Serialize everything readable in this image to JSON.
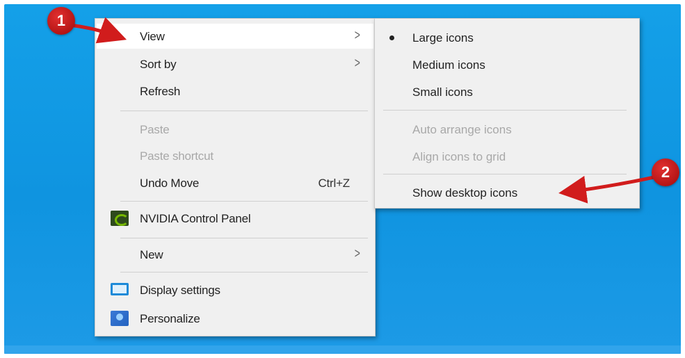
{
  "menu": {
    "items": [
      {
        "label": "View",
        "has_submenu": true,
        "highlighted": true
      },
      {
        "label": "Sort by",
        "has_submenu": true
      },
      {
        "label": "Refresh"
      },
      {
        "label": "Paste",
        "disabled": true
      },
      {
        "label": "Paste shortcut",
        "disabled": true
      },
      {
        "label": "Undo Move",
        "shortcut": "Ctrl+Z"
      },
      {
        "label": "NVIDIA Control Panel",
        "icon": "nvidia-icon"
      },
      {
        "label": "New",
        "has_submenu": true
      },
      {
        "label": "Display settings",
        "icon": "display-icon"
      },
      {
        "label": "Personalize",
        "icon": "personalize-icon"
      }
    ]
  },
  "submenu": {
    "items": [
      {
        "label": "Large icons",
        "selected": true
      },
      {
        "label": "Medium icons"
      },
      {
        "label": "Small icons"
      },
      {
        "label": "Auto arrange icons",
        "disabled": true
      },
      {
        "label": "Align icons to grid",
        "disabled": true
      },
      {
        "label": "Show desktop icons"
      }
    ]
  },
  "callouts": {
    "one": "1",
    "two": "2"
  },
  "icons": {
    "chevron": "chevron-right-icon",
    "bullet": "radio-bullet-icon"
  },
  "colors": {
    "desktop": "#14a0e8",
    "menu_bg": "#f0f0f0",
    "callout": "#c41a1a"
  }
}
